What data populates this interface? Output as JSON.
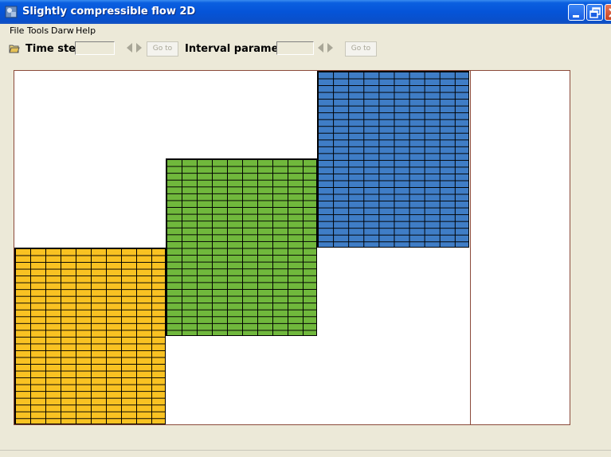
{
  "window": {
    "title": "Slightly compressible flow 2D",
    "icon": "app-icon",
    "controls": [
      "minimize-icon",
      "restore-icon",
      "close-icon"
    ]
  },
  "menu": {
    "items": [
      {
        "label": "File"
      },
      {
        "label": "Tools"
      },
      {
        "label": "Darw"
      },
      {
        "label": "Help"
      }
    ]
  },
  "toolbar": {
    "icon": "open-folder-icon",
    "time_step_label": "Time step",
    "time_step_value": "",
    "goto1_label": "Go to",
    "interval_label": "Interval parameter",
    "interval_value": "",
    "goto2_label": "Go to"
  },
  "canvas": {
    "blocks": [
      {
        "name": "yellow-block",
        "color": "#f9c222"
      },
      {
        "name": "green-block",
        "color": "#70b83c"
      },
      {
        "name": "blue-block",
        "color": "#3f7dc6"
      }
    ],
    "border_color": "#8b4a3a"
  }
}
